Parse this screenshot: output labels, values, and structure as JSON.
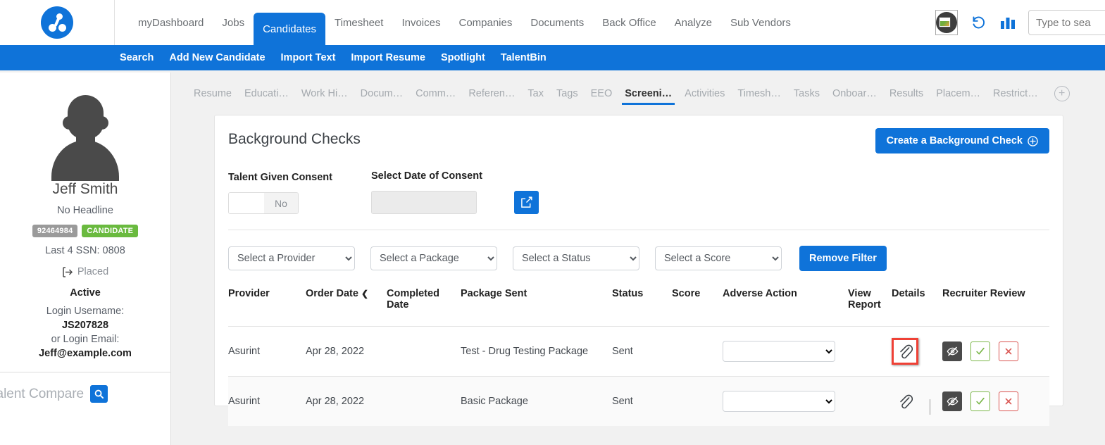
{
  "header": {
    "logo_name": "bullhorn-logo",
    "nav_items": [
      {
        "label": "myDashboard",
        "active": false
      },
      {
        "label": "Jobs",
        "active": false
      },
      {
        "label": "Candidates",
        "active": true
      },
      {
        "label": "Timesheet",
        "active": false
      },
      {
        "label": "Invoices",
        "active": false
      },
      {
        "label": "Companies",
        "active": false
      },
      {
        "label": "Documents",
        "active": false
      },
      {
        "label": "Back Office",
        "active": false
      },
      {
        "label": "Analyze",
        "active": false
      },
      {
        "label": "Sub Vendors",
        "active": false
      }
    ],
    "search_placeholder": "Type to sea",
    "icons": [
      "avatar-image-icon",
      "history-refresh-icon",
      "bar-chart-icon"
    ]
  },
  "subnav": {
    "items": [
      {
        "label": "Search"
      },
      {
        "label": "Add New Candidate"
      },
      {
        "label": "Import Text"
      },
      {
        "label": "Import Resume"
      },
      {
        "label": "Spotlight"
      },
      {
        "label": "TalentBin"
      }
    ]
  },
  "sidebar": {
    "name": "Jeff Smith",
    "headline": "No Headline",
    "id_badge": "92464984",
    "type_badge": "CANDIDATE",
    "ssn": "Last 4 SSN: 0808",
    "placed": "Placed",
    "status": "Active",
    "login_username_label": "Login Username:",
    "login_username": "JS207828",
    "login_email_label": "or Login Email:",
    "login_email": "Jeff@example.com",
    "talent_compare_label": "alent Compare"
  },
  "tabs": [
    {
      "label": "Resume",
      "active": false
    },
    {
      "label": "Educati…",
      "active": false
    },
    {
      "label": "Work Hi…",
      "active": false
    },
    {
      "label": "Docum…",
      "active": false
    },
    {
      "label": "Comm…",
      "active": false
    },
    {
      "label": "Referen…",
      "active": false
    },
    {
      "label": "Tax",
      "active": false
    },
    {
      "label": "Tags",
      "active": false
    },
    {
      "label": "EEO",
      "active": false
    },
    {
      "label": "Screeni…",
      "active": true
    },
    {
      "label": "Activities",
      "active": false
    },
    {
      "label": "Timesh…",
      "active": false
    },
    {
      "label": "Tasks",
      "active": false
    },
    {
      "label": "Onboar…",
      "active": false
    },
    {
      "label": "Results",
      "active": false
    },
    {
      "label": "Placem…",
      "active": false
    },
    {
      "label": "Restrict…",
      "active": false
    }
  ],
  "panel": {
    "title": "Background Checks",
    "create_button": "Create a Background Check",
    "consent_label": "Talent Given Consent",
    "consent_value": "No",
    "date_label": "Select Date of Consent",
    "date_value": "",
    "edit_icon": "edit-square-icon",
    "filters": [
      {
        "name": "provider",
        "selected": "Select a Provider"
      },
      {
        "name": "package",
        "selected": "Select a Package"
      },
      {
        "name": "status",
        "selected": "Select a Status"
      },
      {
        "name": "score",
        "selected": "Select a Score"
      }
    ],
    "remove_filter_button": "Remove Filter",
    "table": {
      "columns": [
        "Provider",
        "Order Date",
        "Completed Date",
        "Package Sent",
        "Status",
        "Score",
        "Adverse Action",
        "View Report",
        "Details",
        "Recruiter Review"
      ],
      "sorted_column": "Order Date",
      "sort_direction": "desc",
      "rows": [
        {
          "provider": "Asurint",
          "order_date": "Apr 28, 2022",
          "completed_date": "",
          "package_sent": "Test - Drug Testing Package",
          "status": "Sent",
          "score": "",
          "adverse_action": "",
          "view_report": "",
          "details_icon": "paperclip-icon",
          "details_highlighted": true
        },
        {
          "provider": "Asurint",
          "order_date": "Apr 28, 2022",
          "completed_date": "",
          "package_sent": "Basic Package",
          "status": "Sent",
          "score": "",
          "adverse_action": "",
          "view_report": "",
          "details_icon": "paperclip-icon",
          "details_highlighted": false
        }
      ],
      "review_icons": [
        "eye-slash-icon",
        "check-square-icon",
        "x-square-icon"
      ]
    }
  },
  "colors": {
    "brand_blue": "#0F73D9",
    "highlight_red": "#ef4136",
    "badge_green": "#6aba3f",
    "badge_gray": "#9a9a9a",
    "page_bg": "#f1f1f1"
  }
}
